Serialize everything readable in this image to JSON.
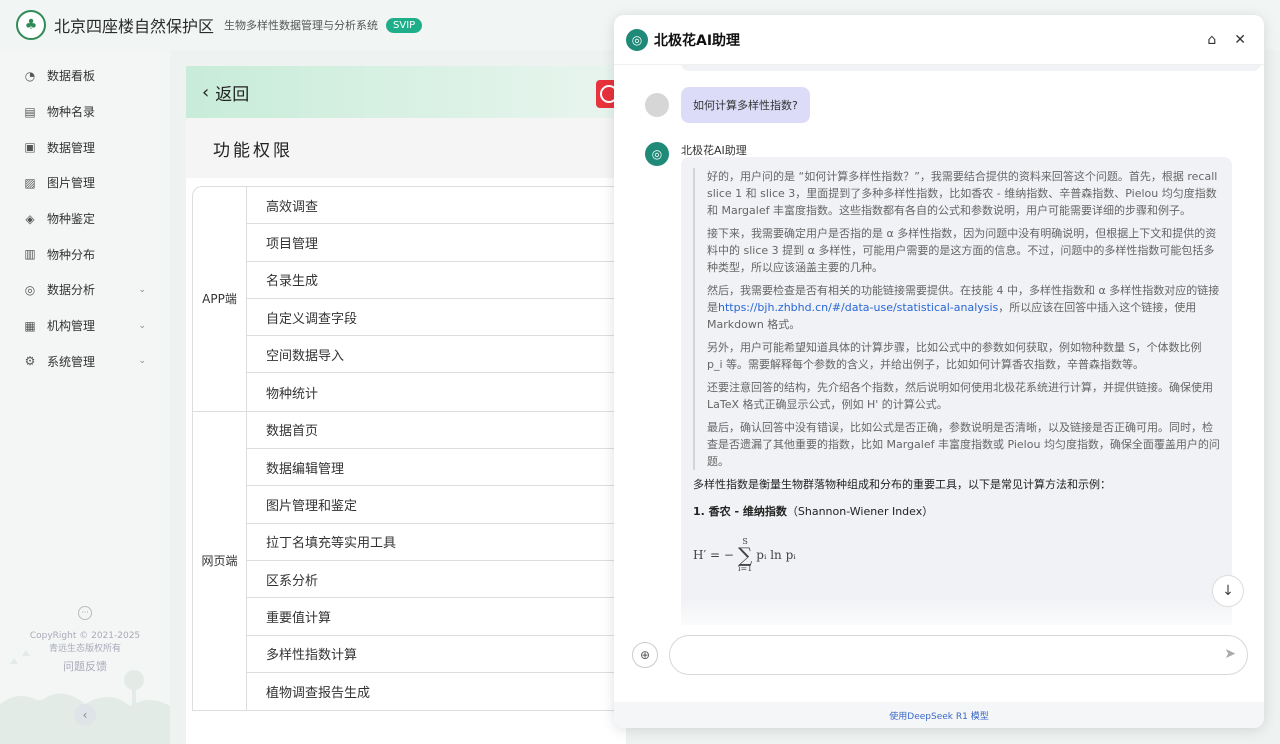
{
  "header": {
    "logo_icon": "tree-logo-icon",
    "brand": "北京四座楼自然保护区",
    "subtitle": "生物多样性数据管理与分析系统",
    "badge": "SVIP"
  },
  "sidebar": {
    "items": [
      {
        "label": "数据看板",
        "icon": "dashboard-icon",
        "glyph": "◔",
        "expandable": false
      },
      {
        "label": "物种名录",
        "icon": "directory-icon",
        "glyph": "▤",
        "expandable": false
      },
      {
        "label": "数据管理",
        "icon": "data-icon",
        "glyph": "▣",
        "expandable": false
      },
      {
        "label": "图片管理",
        "icon": "image-icon",
        "glyph": "▨",
        "expandable": false
      },
      {
        "label": "物种鉴定",
        "icon": "identify-icon",
        "glyph": "◈",
        "expandable": false
      },
      {
        "label": "物种分布",
        "icon": "map-icon",
        "glyph": "▥",
        "expandable": false
      },
      {
        "label": "数据分析",
        "icon": "analysis-icon",
        "glyph": "◎",
        "expandable": true
      },
      {
        "label": "机构管理",
        "icon": "org-icon",
        "glyph": "▦",
        "expandable": true
      },
      {
        "label": "系统管理",
        "icon": "gear-icon",
        "glyph": "⚙",
        "expandable": true
      }
    ],
    "copyright_line1": "CopyRight © 2021-2025",
    "copyright_line2": "青远生态版权所有",
    "feedback": "问题反馈"
  },
  "main": {
    "back_label": "返回",
    "section_title": "功能权限",
    "groups": [
      {
        "label": "APP端",
        "items": [
          "高效调查",
          "项目管理",
          "名录生成",
          "自定义调查字段",
          "空间数据导入",
          "物种统计"
        ]
      },
      {
        "label": "网页端",
        "items": [
          "数据首页",
          "数据编辑管理",
          "图片管理和鉴定",
          "拉丁名填充等实用工具",
          "区系分析",
          "重要值计算",
          "多样性指数计算",
          "植物调查报告生成"
        ]
      }
    ]
  },
  "ai": {
    "title": "北极花AI助理",
    "user_question": "如何计算多样性指数?",
    "bot_name": "北极花AI助理",
    "think": [
      {
        "text": "好的，用户问的是 “如何计算多样性指数？”，我需要结合提供的资料来回答这个问题。首先，根据 recall slice 1 和 slice 3，里面提到了多种多样性指数，比如香农 - 维纳指数、辛普森指数、Pielou 均匀度指数和 Margalef 丰富度指数。这些指数都有各自的公式和参数说明，用户可能需要详细的步骤和例子。"
      },
      {
        "text": "接下来，我需要确定用户是否指的是 α 多样性指数，因为问题中没有明确说明，但根据上下文和提供的资料中的 slice 3 提到 α 多样性，可能用户需要的是这方面的信息。不过，问题中的多样性指数可能包括多种类型，所以应该涵盖主要的几种。"
      },
      {
        "text_before": "然后，我需要检查是否有相关的功能链接需要提供。在技能 4 中，多样性指数和 α 多样性指数对应的链接是",
        "link": "https://bjh.zhbhd.cn/#/data-use/statistical-analysis",
        "text_after": "，所以应该在回答中插入这个链接，使用 Markdown 格式。"
      },
      {
        "text": "另外，用户可能希望知道具体的计算步骤，比如公式中的参数如何获取，例如物种数量 S，个体数比例 p_i 等。需要解释每个参数的含义，并给出例子，比如如何计算香农指数，辛普森指数等。"
      },
      {
        "text": "还要注意回答的结构，先介绍各个指数，然后说明如何使用北极花系统进行计算，并提供链接。确保使用 LaTeX 格式正确显示公式，例如 H' 的计算公式。"
      },
      {
        "text": "最后，确认回答中没有错误，比如公式是否正确，参数说明是否清晰，以及链接是否正确可用。同时，检查是否遗漏了其他重要的指数，比如 Margalef 丰富度指数或 Pielou 均匀度指数，确保全面覆盖用户的问题。"
      }
    ],
    "answer_intro": "多样性指数是衡量生物群落物种组成和分布的重要工具，以下是常见计算方法和示例：",
    "answer_heading": "1. 香农 - 维纳指数",
    "answer_heading_en": "（Shannon-Wiener Index）",
    "formula": {
      "lhs": "H′ = −",
      "upper": "S",
      "lower": "i=1",
      "body": "pᵢ ln pᵢ"
    },
    "input_placeholder": "",
    "model_note": "使用DeepSeek R1 模型"
  },
  "colors": {
    "accent": "#1fae8a",
    "brand_green": "#2e8b57",
    "link": "#2867d8",
    "user_bubble": "#dcdcf8"
  }
}
